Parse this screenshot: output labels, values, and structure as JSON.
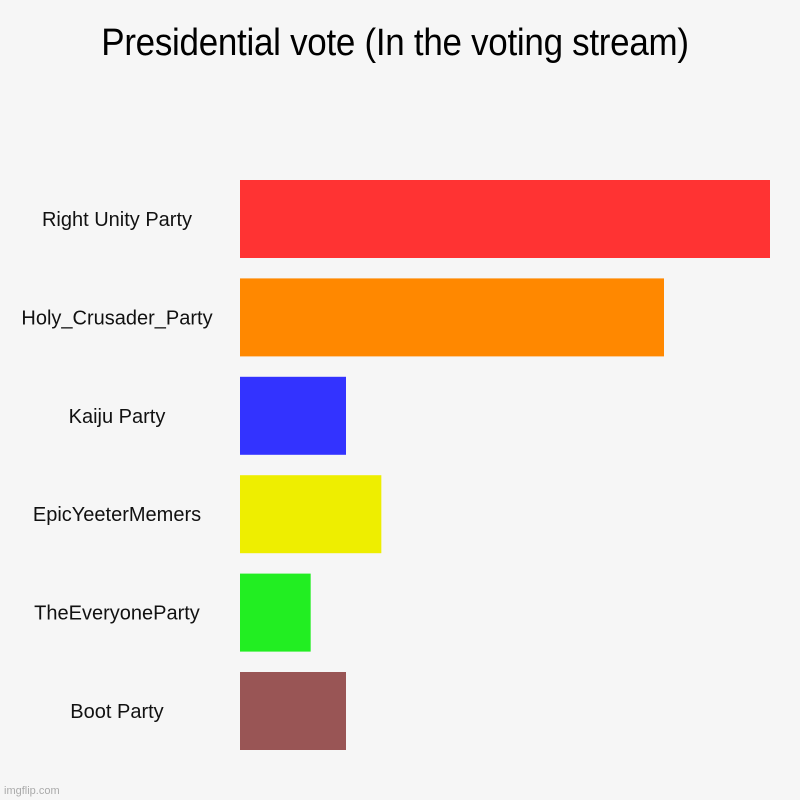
{
  "chart_data": {
    "type": "bar",
    "orientation": "horizontal",
    "title": "Presidential vote (In the voting stream)",
    "xlabel": "",
    "ylabel": "",
    "categories": [
      "Right Unity Party",
      "Holy_Crusader_Party",
      "Kaiju Party",
      "EpicYeeterMemers",
      "TheEveryoneParty",
      "Boot Party"
    ],
    "values": [
      15,
      12,
      3,
      4,
      2,
      3
    ],
    "colors": [
      "#ff3333",
      "#ff8800",
      "#3333ff",
      "#eeee00",
      "#22ee22",
      "#995555"
    ],
    "xlim": [
      0,
      15
    ],
    "grid": false,
    "legend": "none"
  },
  "watermark": "imgflip.com"
}
